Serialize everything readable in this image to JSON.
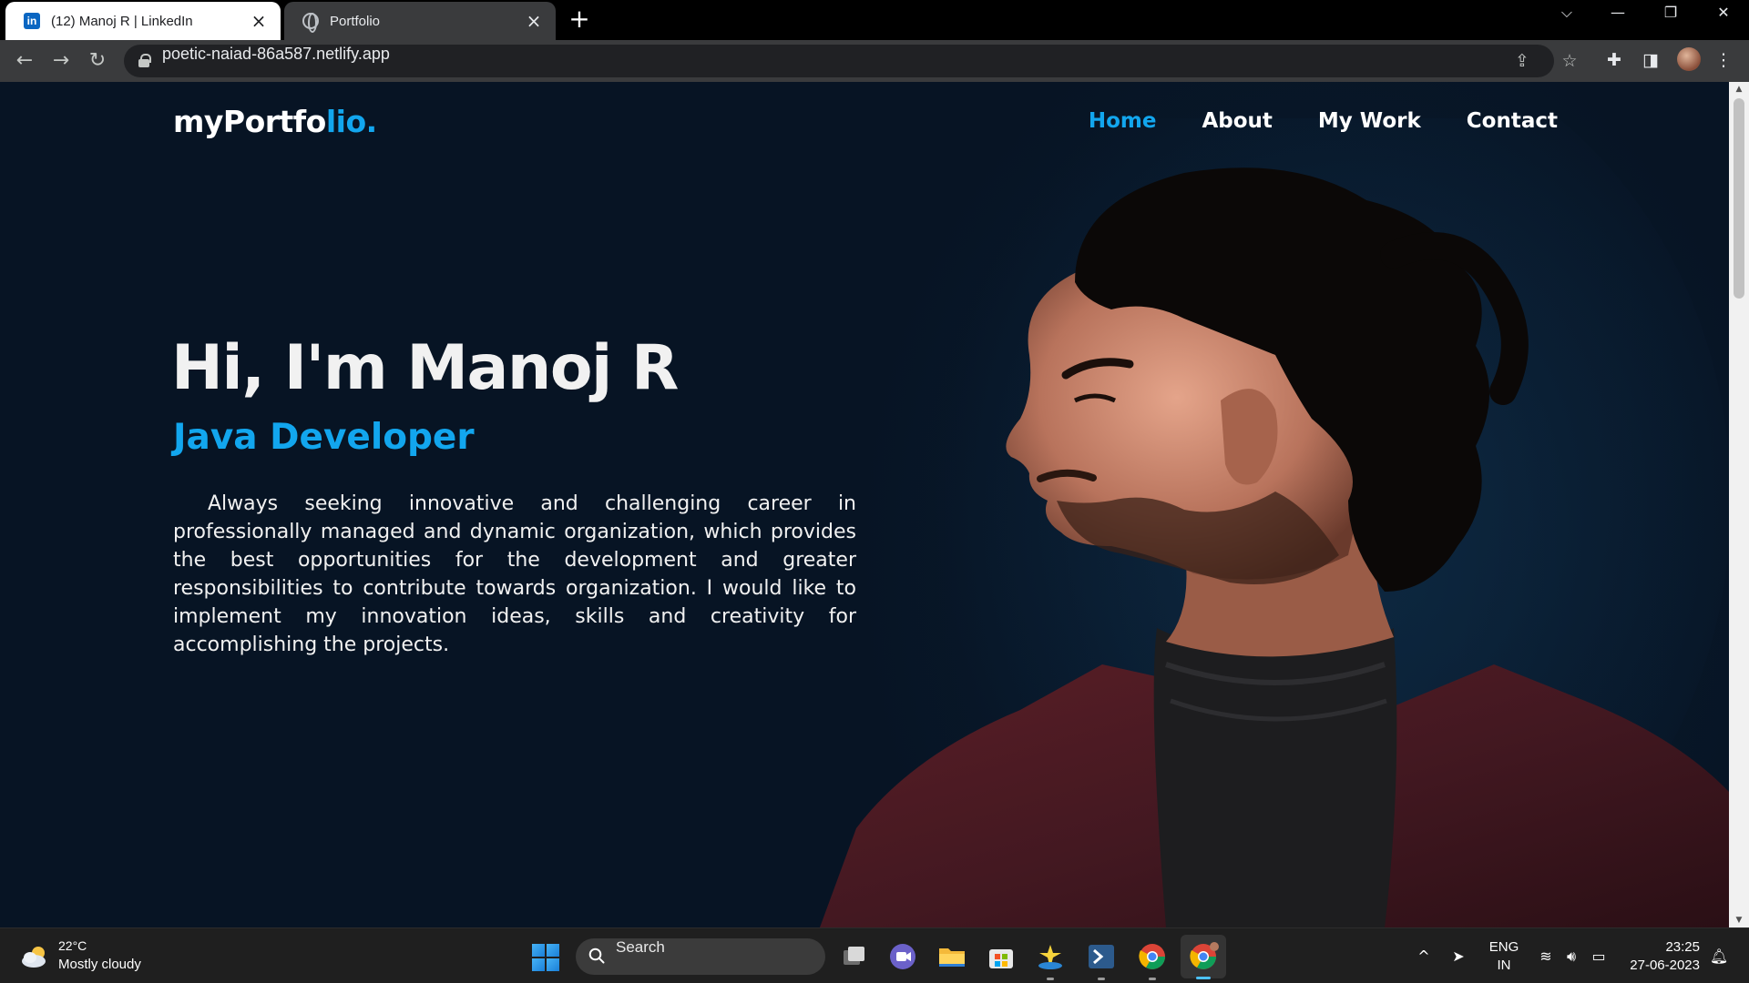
{
  "browser": {
    "tabs": [
      {
        "title": "(12) Manoj R | LinkedIn",
        "favicon": "linkedin-icon",
        "favicon_text": "in",
        "active": false
      },
      {
        "title": "Portfolio",
        "favicon": "globe-icon",
        "active": true
      }
    ],
    "new_tab_glyph": "+",
    "window_controls": {
      "tab_search": "⌵",
      "minimize": "—",
      "restore": "❐",
      "close": "✕"
    },
    "toolbar": {
      "back": "←",
      "forward": "→",
      "reload": "↻",
      "url": "poetic-naiad-86a587.netlify.app",
      "share_icon": "⇪",
      "bookmark_icon": "☆",
      "extensions_icon": "✚",
      "sidepanel_icon": "◨",
      "menu_icon": "⋮"
    }
  },
  "page": {
    "logo": {
      "main": "myPortfo",
      "accent": "lio."
    },
    "nav": [
      {
        "label": "Home",
        "active": true
      },
      {
        "label": "About",
        "active": false
      },
      {
        "label": "My Work",
        "active": false
      },
      {
        "label": "Contact",
        "active": false
      }
    ],
    "hero": {
      "title": "Hi, I'm Manoj R",
      "subtitle": "Java Developer",
      "description": "Always seeking innovative and challenging career in professionally managed and dynamic organization, which provides the best opportunities for the development and greater responsibilities to contribute towards organization. I would like to implement my innovation ideas, skills and creativity for accomplishing the projects."
    },
    "colors": {
      "accent": "#12a6ee",
      "background": "#071424",
      "text": "#f1f1f1"
    }
  },
  "taskbar": {
    "weather": {
      "temp": "22°C",
      "condition": "Mostly cloudy",
      "icon": "partly-cloudy-icon"
    },
    "search_label": "Search",
    "apps": [
      "task-view-icon",
      "teams-chat-icon",
      "file-explorer-icon",
      "microsoft-store-icon",
      "app-icon",
      "vscode-icon",
      "chrome-icon",
      "chrome-profile-icon"
    ],
    "tray": {
      "chevron": "^",
      "lang": "ENG",
      "region": "IN",
      "time": "23:25",
      "date": "27-06-2023"
    }
  }
}
